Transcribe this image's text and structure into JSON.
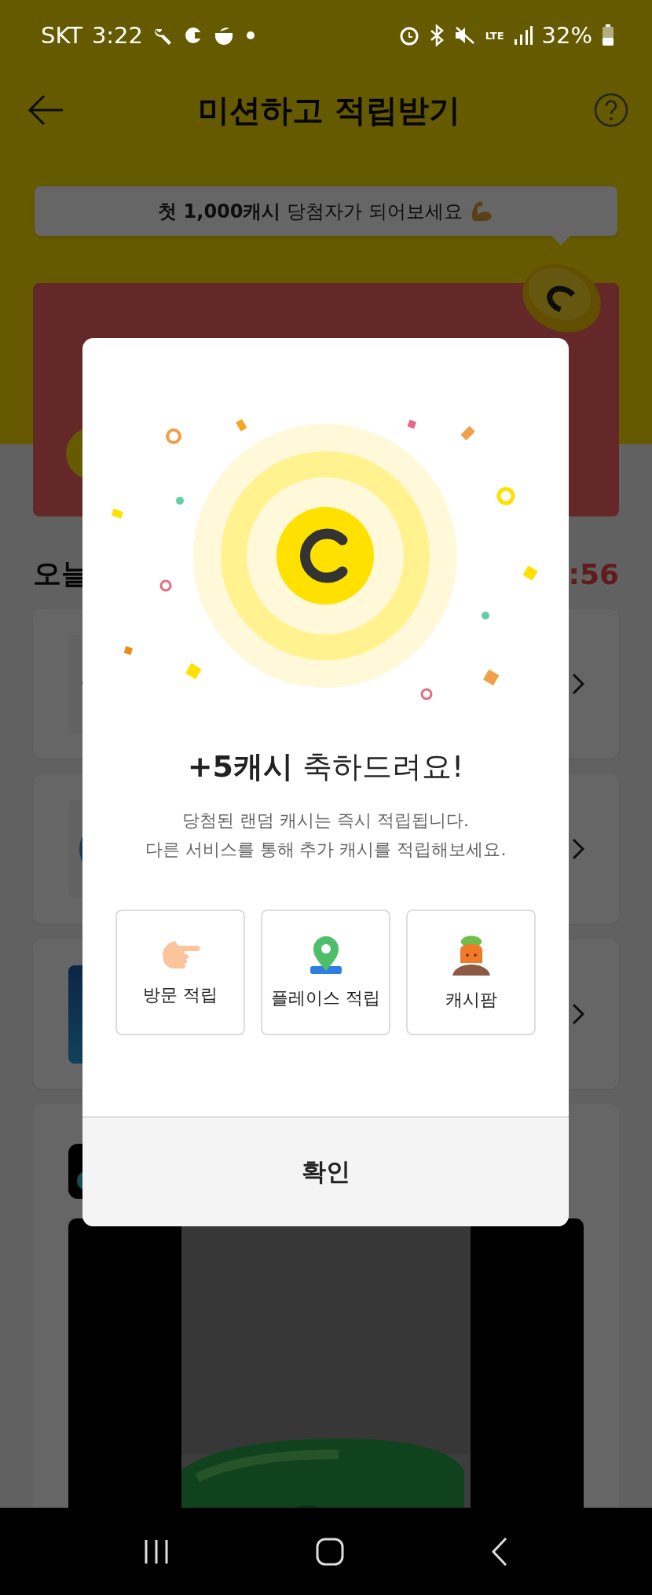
{
  "status_bar": {
    "carrier": "SKT",
    "time": "3:22",
    "network": "LTE",
    "battery": "32%"
  },
  "header": {
    "title": "미션하고 적립받기"
  },
  "tooltip": {
    "text": "**첫 1,000캐시** 당첨자가 되어보세요"
  },
  "section": {
    "title": "오늘",
    "timer": ":56"
  },
  "mission_cards": [
    {
      "kind": "ticket"
    },
    {
      "kind": "circle"
    },
    {
      "kind": "tile"
    }
  ],
  "dialog": {
    "title": "**+5캐시** 축하드려요!",
    "message": [
      "당첨된 랜덤 캐시는 즉시 적립됩니다.",
      "다른 서비스를 통해 추가 캐시를 적립해보세요."
    ],
    "options": [
      {
        "kind": "hand",
        "label": "방문 적립"
      },
      {
        "kind": "pin",
        "label": "플레이스 적립"
      },
      {
        "kind": "farm",
        "label": "캐시팜"
      }
    ],
    "confirm": "확인"
  }
}
